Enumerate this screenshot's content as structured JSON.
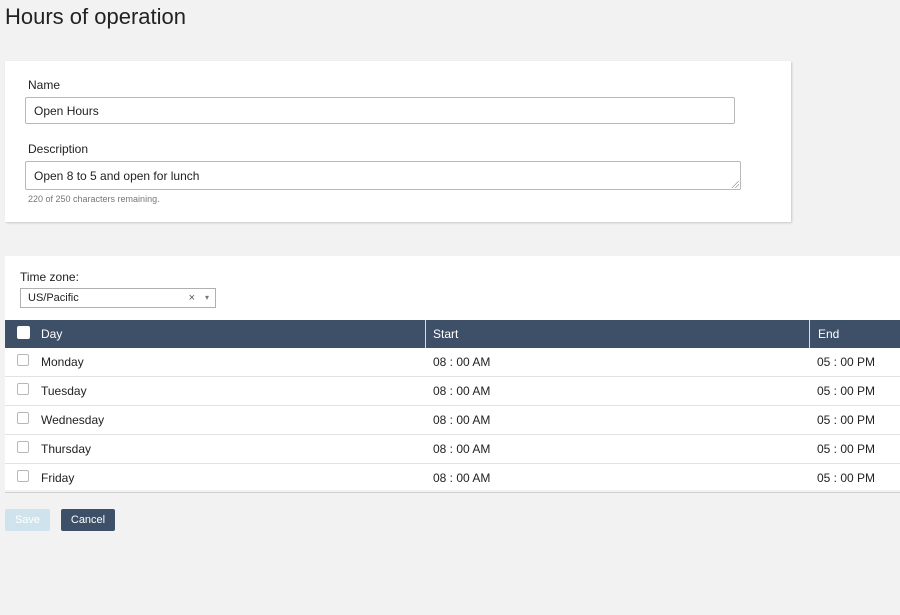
{
  "page": {
    "title": "Hours of operation"
  },
  "form": {
    "name_label": "Name",
    "name_value": "Open Hours",
    "description_label": "Description",
    "description_value": "Open 8 to 5 and open for lunch",
    "char_hint": "220 of 250 characters remaining."
  },
  "timezone": {
    "label": "Time zone:",
    "value": "US/Pacific",
    "clear_icon": "×",
    "caret_icon": "▾"
  },
  "table": {
    "columns": [
      "Day",
      "Start",
      "End"
    ],
    "rows": [
      {
        "day": "Monday",
        "start": "08 : 00 AM",
        "end": "05 : 00 PM"
      },
      {
        "day": "Tuesday",
        "start": "08 : 00 AM",
        "end": "05 : 00 PM"
      },
      {
        "day": "Wednesday",
        "start": "08 : 00 AM",
        "end": "05 : 00 PM"
      },
      {
        "day": "Thursday",
        "start": "08 : 00 AM",
        "end": "05 : 00 PM"
      },
      {
        "day": "Friday",
        "start": "08 : 00 AM",
        "end": "05 : 00 PM"
      }
    ]
  },
  "buttons": {
    "save": "Save",
    "cancel": "Cancel"
  },
  "colors": {
    "header_bg": "#3d5068",
    "cancel_bg": "#3d5068",
    "save_disabled_bg": "#cfe3ec"
  }
}
